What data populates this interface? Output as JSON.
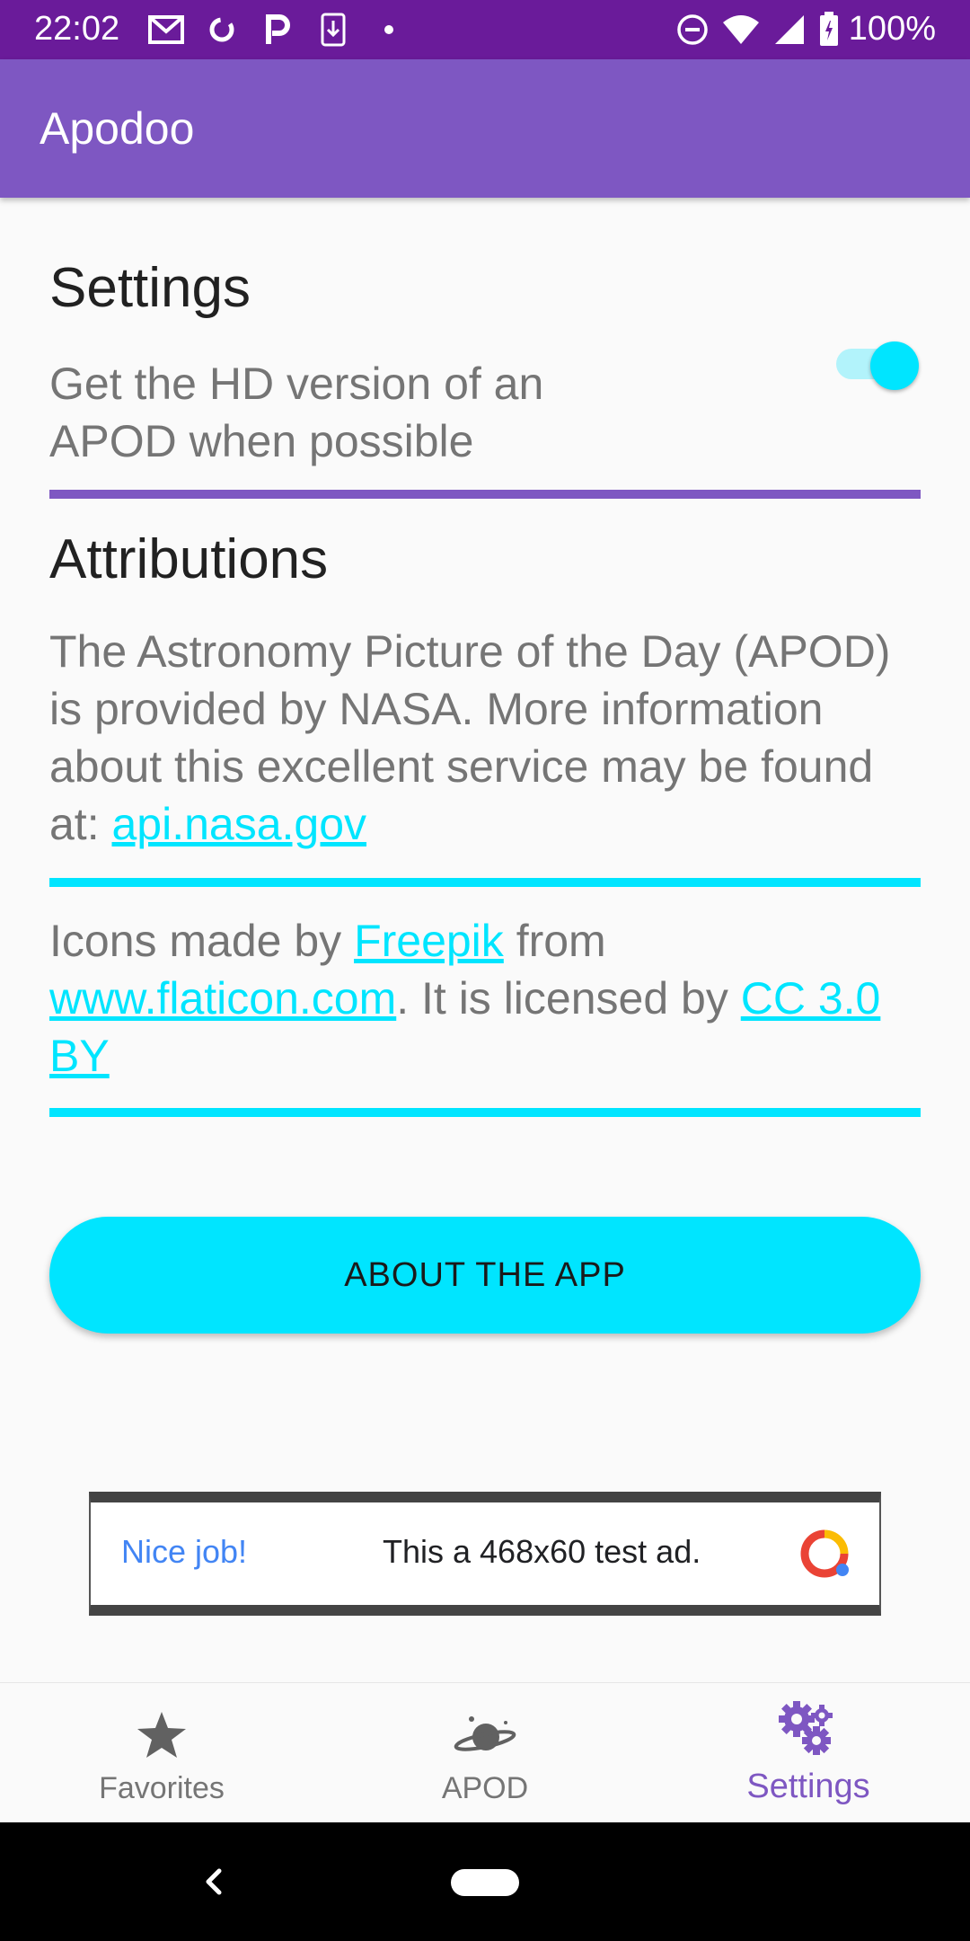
{
  "status_bar": {
    "time": "22:02",
    "battery": "100%",
    "icons_left": [
      "gmail-icon",
      "sync-icon",
      "p-icon",
      "download-icon",
      "dot-icon"
    ],
    "icons_right": [
      "dnd-icon",
      "wifi-icon",
      "signal-icon",
      "battery-icon"
    ]
  },
  "app_bar": {
    "title": "Apodoo"
  },
  "settings": {
    "title": "Settings",
    "hd_label": "Get the HD version of an APOD when possible",
    "hd_enabled": true
  },
  "attributions": {
    "title": "Attributions",
    "apod_text": "The Astronomy Picture of the Day (APOD) is provided by NASA. More information about this excellent service may be found at: ",
    "apod_link": "api.nasa.gov",
    "icons_prefix": "Icons made by ",
    "freepik_link": "Freepik",
    "icons_middle": " from ",
    "flaticon_link": "www.flaticon.com",
    "icons_license": ". It is licensed by ",
    "cc_link": "CC 3.0 BY"
  },
  "about_button": {
    "label": "ABOUT THE APP"
  },
  "ad": {
    "nice_job": "Nice job!",
    "text": "This a 468x60 test ad."
  },
  "bottom_nav": {
    "items": [
      {
        "label": "Favorites",
        "icon": "star-icon",
        "active": false
      },
      {
        "label": "APOD",
        "icon": "planet-icon",
        "active": false
      },
      {
        "label": "Settings",
        "icon": "gears-icon",
        "active": true
      }
    ]
  },
  "colors": {
    "status_bar": "#6a1b9a",
    "app_bar": "#7e57c2",
    "accent": "#00e5ff"
  }
}
